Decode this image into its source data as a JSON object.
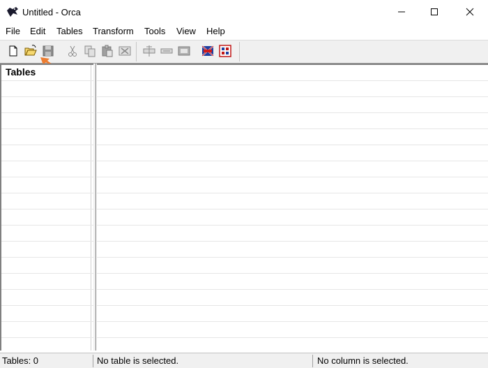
{
  "window": {
    "title": "Untitled - Orca",
    "controls": {
      "minimize_icon": "minimize-icon",
      "maximize_icon": "maximize-icon",
      "close_icon": "close-icon"
    }
  },
  "menu": [
    "File",
    "Edit",
    "Tables",
    "Transform",
    "Tools",
    "View",
    "Help"
  ],
  "toolbar": {
    "icons": [
      "new-file-icon",
      "open-folder-icon",
      "save-icon",
      "cut-icon",
      "copy-icon",
      "paste-icon",
      "delete-icon",
      "add-row-icon",
      "drop-row-icon",
      "table-icon",
      "validate-icon",
      "merge-module-icon"
    ],
    "highlighted": "open-folder-icon",
    "highlight_color": "#ed7d31"
  },
  "left_pane": {
    "header": "Tables"
  },
  "status": {
    "tables": "Tables: 0",
    "table_selection": "No table is selected.",
    "column_selection": "No column is selected."
  }
}
